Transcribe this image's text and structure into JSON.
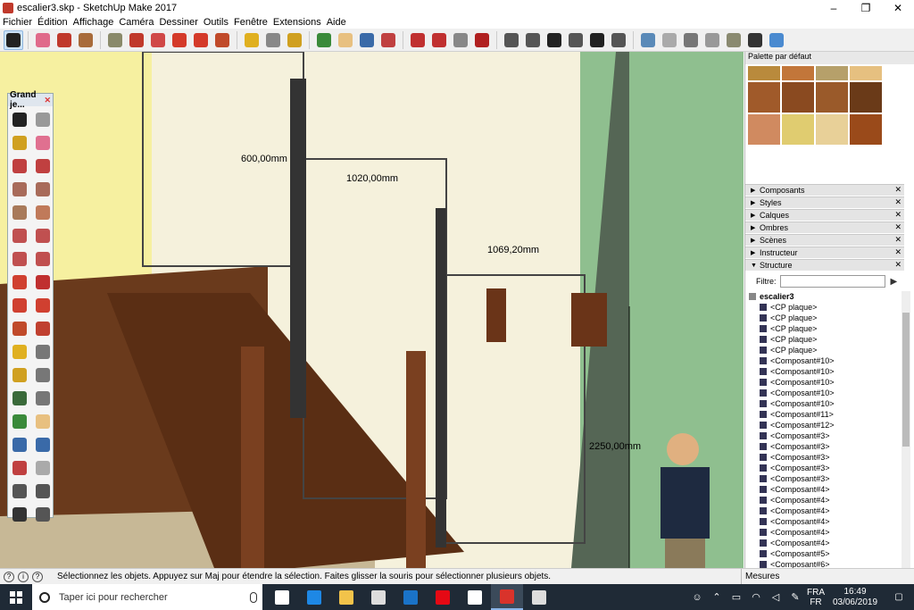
{
  "window": {
    "title": "escalier3.skp - SketchUp Make 2017",
    "controls": [
      "–",
      "❐",
      "✕"
    ]
  },
  "menu": [
    "Fichier",
    "Édition",
    "Affichage",
    "Caméra",
    "Dessiner",
    "Outils",
    "Fenêtre",
    "Extensions",
    "Aide"
  ],
  "toolbar": {
    "tools": [
      {
        "name": "select-tool-icon",
        "color": "#222222"
      },
      {
        "name": "eraser-tool-icon",
        "color": "#e06a8a"
      },
      {
        "name": "pencil-tool-icon",
        "color": "#c0392b"
      },
      {
        "name": "arc-tool-icon",
        "color": "#a86b3a"
      },
      {
        "name": "shapes-tool-icon",
        "color": "#8a8a6a"
      },
      {
        "name": "push-pull-tool-icon",
        "color": "#c0392b"
      },
      {
        "name": "follow-me-tool-icon",
        "color": "#d04848"
      },
      {
        "name": "move-tool-icon",
        "color": "#d43a2a"
      },
      {
        "name": "rotate-tool-icon",
        "color": "#d43a2a"
      },
      {
        "name": "scale-tool-icon",
        "color": "#c04a2a"
      },
      {
        "name": "tape-measure-tool-icon",
        "color": "#e0b020"
      },
      {
        "name": "text-tool-icon",
        "color": "#888888"
      },
      {
        "name": "paint-bucket-tool-icon",
        "color": "#d0a020"
      },
      {
        "name": "orbit-tool-icon",
        "color": "#3a8a3a"
      },
      {
        "name": "pan-tool-icon",
        "color": "#e8c080"
      },
      {
        "name": "zoom-tool-icon",
        "color": "#3a6aa8"
      },
      {
        "name": "zoom-extents-tool-icon",
        "color": "#c04040"
      },
      {
        "name": "warehouse-icon",
        "color": "#c03030"
      },
      {
        "name": "extension-warehouse-icon",
        "color": "#c03030"
      },
      {
        "name": "share-model-icon",
        "color": "#888888"
      },
      {
        "name": "ruby-icon",
        "color": "#b02020"
      },
      {
        "name": "iso-view-icon",
        "color": "#555555"
      },
      {
        "name": "top-view-icon",
        "color": "#555555"
      },
      {
        "name": "front-view-icon",
        "color": "#222222"
      },
      {
        "name": "right-view-icon",
        "color": "#555555"
      },
      {
        "name": "back-view-icon",
        "color": "#222222"
      },
      {
        "name": "left-view-icon",
        "color": "#555555"
      },
      {
        "name": "xray-style-icon",
        "color": "#5a8ab8"
      },
      {
        "name": "wireframe-style-icon",
        "color": "#aaaaaa"
      },
      {
        "name": "hidden-line-style-icon",
        "color": "#777777"
      },
      {
        "name": "shaded-style-icon",
        "color": "#999999"
      },
      {
        "name": "textured-style-icon",
        "color": "#8a8a70"
      },
      {
        "name": "monochrome-style-icon",
        "color": "#333333"
      },
      {
        "name": "layers-style-icon",
        "color": "#4a8ad0"
      }
    ]
  },
  "tool_palette": {
    "title": "Grand je...",
    "tools": [
      {
        "name": "select-icon",
        "color": "#222222"
      },
      {
        "name": "make-component-icon",
        "color": "#999999"
      },
      {
        "name": "paint-icon",
        "color": "#d0a020"
      },
      {
        "name": "eraser-icon",
        "color": "#e07090"
      },
      {
        "name": "line-icon",
        "color": "#c04040"
      },
      {
        "name": "freehand-icon",
        "color": "#c04040"
      },
      {
        "name": "rectangle-icon",
        "color": "#a86b5a"
      },
      {
        "name": "rotated-rectangle-icon",
        "color": "#a86b5a"
      },
      {
        "name": "circle-icon",
        "color": "#a87a5a"
      },
      {
        "name": "polygon-icon",
        "color": "#c07a5a"
      },
      {
        "name": "arc-icon",
        "color": "#c05050"
      },
      {
        "name": "arc2-icon",
        "color": "#c05050"
      },
      {
        "name": "arc3-icon",
        "color": "#c05050"
      },
      {
        "name": "pie-icon",
        "color": "#c05050"
      },
      {
        "name": "move-icon",
        "color": "#d04030"
      },
      {
        "name": "push-pull-icon",
        "color": "#c03030"
      },
      {
        "name": "rotate-icon",
        "color": "#d04030"
      },
      {
        "name": "follow-me-icon",
        "color": "#d04030"
      },
      {
        "name": "scale-icon",
        "color": "#c04a2a"
      },
      {
        "name": "offset-icon",
        "color": "#c04030"
      },
      {
        "name": "tape-icon",
        "color": "#e0b020"
      },
      {
        "name": "dimension-icon",
        "color": "#777777"
      },
      {
        "name": "protractor-icon",
        "color": "#d0a020"
      },
      {
        "name": "text-icon",
        "color": "#777777"
      },
      {
        "name": "axes-icon",
        "color": "#3a6a3a"
      },
      {
        "name": "3d-text-icon",
        "color": "#777777"
      },
      {
        "name": "orbit-icon",
        "color": "#3a8a3a"
      },
      {
        "name": "pan-icon",
        "color": "#e8c080"
      },
      {
        "name": "zoom-icon",
        "color": "#3a6aa8"
      },
      {
        "name": "zoom-window-icon",
        "color": "#3a6aa8"
      },
      {
        "name": "zoom-extents-icon",
        "color": "#c04040"
      },
      {
        "name": "previous-icon",
        "color": "#aaaaaa"
      },
      {
        "name": "position-camera-icon",
        "color": "#555555"
      },
      {
        "name": "look-around-icon",
        "color": "#555555"
      },
      {
        "name": "walk-icon",
        "color": "#333333"
      },
      {
        "name": "section-plane-icon",
        "color": "#555555"
      }
    ]
  },
  "viewport": {
    "dimensions": [
      "600,00mm",
      "1020,00mm",
      "1069,20mm",
      "2250,00mm"
    ]
  },
  "right_panel": {
    "title": "Palette par défaut",
    "materials": [
      "#b98a3c",
      "#c2763a",
      "#b6a06a",
      "#e6c080",
      "#a05a2a",
      "#8a4a20",
      "#9a5a2a",
      "#6a3a18",
      "#d08a60",
      "#e0cc70",
      "#e8d098",
      "#9a4a1a"
    ],
    "trays": [
      {
        "label": "Composants",
        "open": false
      },
      {
        "label": "Styles",
        "open": false
      },
      {
        "label": "Calques",
        "open": false
      },
      {
        "label": "Ombres",
        "open": false
      },
      {
        "label": "Scènes",
        "open": false
      },
      {
        "label": "Instructeur",
        "open": false
      },
      {
        "label": "Structure",
        "open": true
      }
    ],
    "filter_label": "Filtre:",
    "outliner": {
      "root": "escalier3",
      "items": [
        "<CP plaque>",
        "<CP plaque>",
        "<CP plaque>",
        "<CP plaque>",
        "<CP plaque>",
        "<Composant#10>",
        "<Composant#10>",
        "<Composant#10>",
        "<Composant#10>",
        "<Composant#10>",
        "<Composant#11>",
        "<Composant#12>",
        "<Composant#3>",
        "<Composant#3>",
        "<Composant#3>",
        "<Composant#3>",
        "<Composant#3>",
        "<Composant#4>",
        "<Composant#4>",
        "<Composant#4>",
        "<Composant#4>",
        "<Composant#4>",
        "<Composant#4>",
        "<Composant#5>",
        "<Composant#6>"
      ]
    }
  },
  "status": {
    "message": "Sélectionnez les objets. Appuyez sur Maj pour étendre la sélection. Faites glisser la souris pour sélectionner plusieurs objets.",
    "measurements_label": "Mesures"
  },
  "taskbar": {
    "search_placeholder": "Taper ici pour rechercher",
    "apps": [
      {
        "name": "task-view-icon",
        "color": "#ffffff"
      },
      {
        "name": "edge-icon",
        "color": "#1e88e5"
      },
      {
        "name": "file-explorer-icon",
        "color": "#f2c34a"
      },
      {
        "name": "store-icon",
        "color": "#dddddd"
      },
      {
        "name": "outlook-icon",
        "color": "#1a73c8"
      },
      {
        "name": "netflix-icon",
        "color": "#e50914"
      },
      {
        "name": "plus-icon",
        "color": "#ffffff"
      },
      {
        "name": "sketchup-icon",
        "color": "#d9332b"
      },
      {
        "name": "photos-icon",
        "color": "#dddddd"
      }
    ],
    "lang_top": "FRA",
    "lang_bottom": "FR",
    "time": "16:49",
    "date": "03/06/2019"
  }
}
